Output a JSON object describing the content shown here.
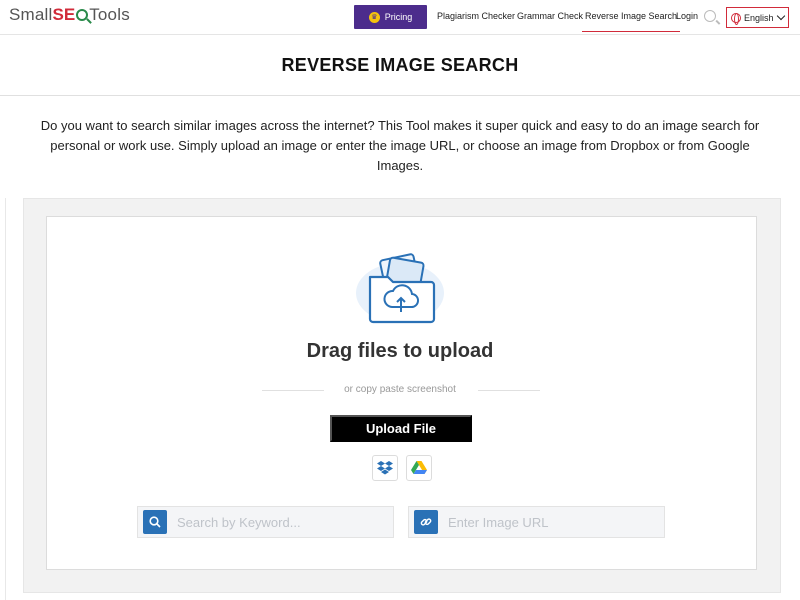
{
  "header": {
    "logo": {
      "part1": "Small",
      "part2": "SE",
      "part3": "Tools"
    },
    "pricing_label": "Pricing",
    "nav": [
      "Plagiarism Checker",
      "Grammar Check",
      "Reverse Image Search",
      "Login"
    ],
    "language": "English"
  },
  "page": {
    "title": "REVERSE IMAGE SEARCH",
    "description": "Do you want to search similar images across the internet? This Tool makes it super quick and easy to do an image search for personal or work use. Simply upload an image or enter the image URL, or choose an image from Dropbox or from Google Images."
  },
  "uploader": {
    "drag_text": "Drag files to upload",
    "or_text": "or copy paste screenshot",
    "upload_button": "Upload File",
    "keyword_placeholder": "Search by Keyword...",
    "url_placeholder": "Enter Image URL"
  },
  "colors": {
    "accent": "#d12b3a",
    "pricing_bg": "#4c2c8c",
    "icon_blue": "#2a71b6"
  }
}
